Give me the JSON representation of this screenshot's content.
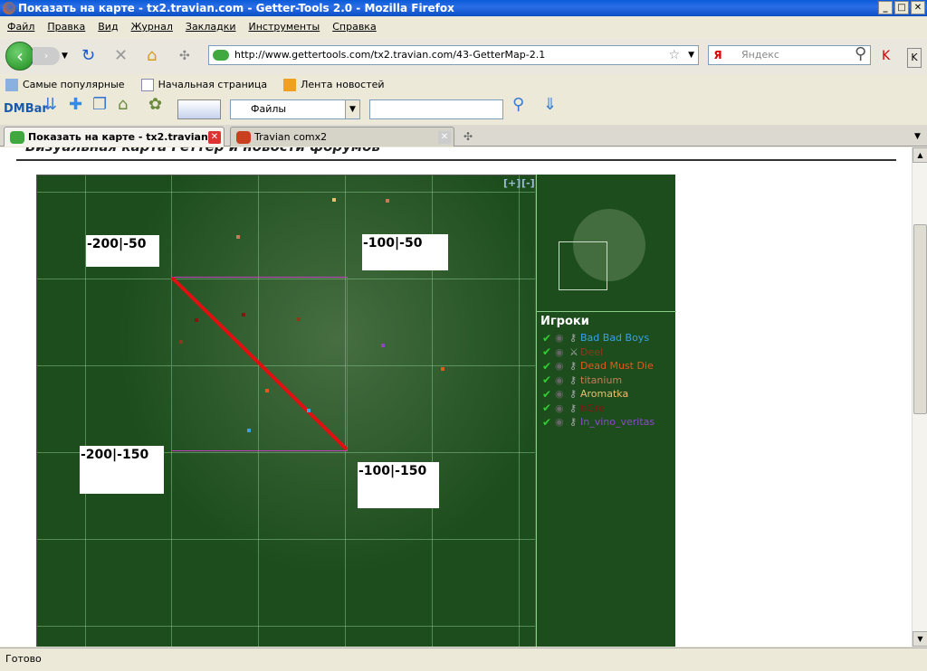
{
  "window": {
    "title": "Показать на карте - tx2.travian.com - Getter-Tools 2.0 - Mozilla Firefox",
    "min": "_",
    "max": "□",
    "close": "✕"
  },
  "menu": [
    "Файл",
    "Правка",
    "Вид",
    "Журнал",
    "Закладки",
    "Инструменты",
    "Справка"
  ],
  "nav": {
    "url": "http://www.gettertools.com/tx2.travian.com/43-GetterMap-2.1",
    "search_placeholder": "Яндекс",
    "search_engine": "Я"
  },
  "bookmarks": [
    "Самые популярные",
    "Начальная страница",
    "Лента новостей"
  ],
  "dmbar": {
    "logo": "DMBar",
    "select": "Файлы"
  },
  "tabs": [
    {
      "label": "Показать на карте - tx2.travian...",
      "active": true
    },
    {
      "label": "Travian comx2",
      "active": false
    }
  ],
  "page": {
    "heading": "Визуальная карта Геттер и новости форумов"
  },
  "map": {
    "zoom_in": "[+]",
    "zoom_out": "[-]",
    "coords": [
      "-200|-50",
      "-100|-50",
      "-200|-150",
      "-100|-150"
    ]
  },
  "players": {
    "title": "Игроки",
    "items": [
      {
        "name": "Bad Bad Boys",
        "color": "#3aa0e8"
      },
      {
        "name": "Deel",
        "color": "#8a3a1a"
      },
      {
        "name": "Dead Must Die",
        "color": "#e05a1a"
      },
      {
        "name": "titanium",
        "color": "#c87a5a"
      },
      {
        "name": "Aromatka",
        "color": "#e8c070"
      },
      {
        "name": "tiGre",
        "color": "#7a1a10"
      },
      {
        "name": "In_vino_veritas",
        "color": "#8a4ac8"
      }
    ]
  },
  "status": "Готово"
}
